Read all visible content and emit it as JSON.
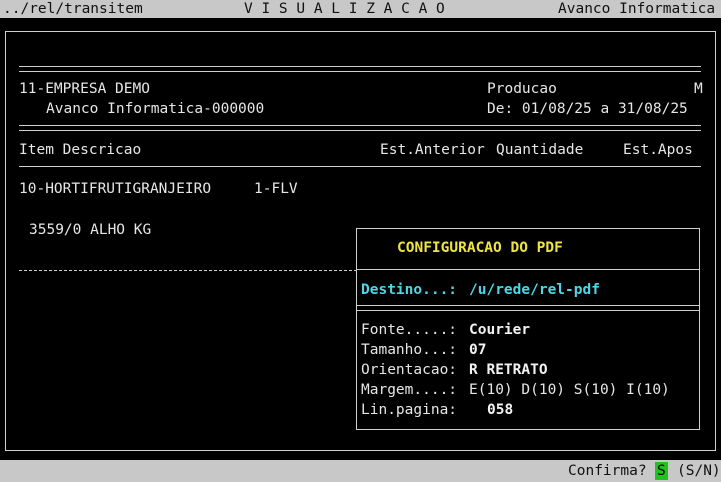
{
  "topbar": {
    "path": "../rel/transitem",
    "title": "V I S U A L I Z A C A O",
    "company": "Avanco Informatica"
  },
  "report": {
    "company_line": "11-EMPRESA DEMO",
    "company_sub": "Avanco Informatica-000000",
    "type_label": "Producao",
    "type_flag": "M",
    "period": "De: 01/08/25 a 31/08/25",
    "columns": {
      "item_desc": "Item Descricao",
      "prev_stock": "Est.Anterior",
      "qty": "Quantidade",
      "after_stock": "Est.Apos"
    },
    "group": "10-HORTIFRUTIGRANJEIRO",
    "group_code": "1-FLV",
    "item": "3559/0 ALHO KG"
  },
  "pdf_config": {
    "title": "CONFIGURACAO DO PDF",
    "destination_label": "Destino...:",
    "destination_value": "/u/rede/rel-pdf",
    "font_label": "Fonte.....:",
    "font_value": "Courier",
    "size_label": "Tamanho...:",
    "size_value": "07",
    "orientation_label": "Orientacao:",
    "orientation_value": "R RETRATO",
    "margin_label": "Margem....:",
    "margin_value": "E(10) D(10) S(10) I(10)",
    "lines_label": "Lin.pagina:",
    "lines_value": "058"
  },
  "confirm": {
    "prompt": "Confirma?",
    "value": "S",
    "options": "(S/N)"
  }
}
